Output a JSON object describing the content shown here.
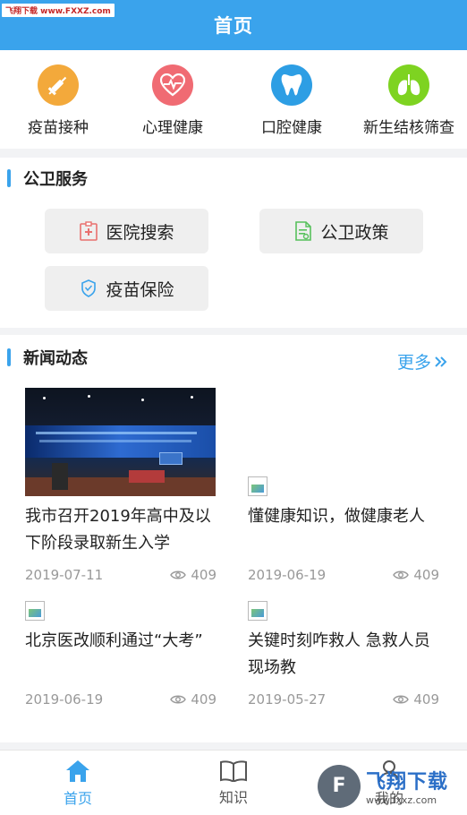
{
  "header": {
    "title": "首页"
  },
  "watermark": {
    "top": "飞翔下载 www.FXXZ.com",
    "brand": "飞翔下载",
    "url": "www.fxxz.com"
  },
  "quick_entries": [
    {
      "label": "疫苗接种",
      "icon": "syringe-icon",
      "color": "#f3a93b"
    },
    {
      "label": "心理健康",
      "icon": "heart-pulse-icon",
      "color": "#f06b73"
    },
    {
      "label": "口腔健康",
      "icon": "tooth-icon",
      "color": "#2d9ee4"
    },
    {
      "label": "新生结核筛查",
      "icon": "lungs-icon",
      "color": "#7ed321"
    }
  ],
  "public_health": {
    "title": "公卫服务",
    "services": [
      {
        "label": "医院搜索",
        "icon": "hospital-icon",
        "color": "#e9706f"
      },
      {
        "label": "公卫政策",
        "icon": "document-icon",
        "color": "#57c15c"
      },
      {
        "label": "疫苗保险",
        "icon": "shield-icon",
        "color": "#3aa3ec"
      }
    ]
  },
  "news": {
    "title": "新闻动态",
    "more_label": "更多",
    "items": [
      {
        "title": "我市召开2019年高中及以下阶段录取新生入学",
        "date": "2019-07-11",
        "views": "409"
      },
      {
        "title": "懂健康知识，做健康老人",
        "date": "2019-06-19",
        "views": "409"
      },
      {
        "title": "北京医改顺利通过“大考”",
        "date": "2019-06-19",
        "views": "409"
      },
      {
        "title": "关键时刻咋救人 急救人员现场教",
        "date": "2019-05-27",
        "views": "409"
      }
    ]
  },
  "tabs": [
    {
      "label": "首页",
      "icon": "home-icon",
      "active": true
    },
    {
      "label": "知识",
      "icon": "book-icon",
      "active": false
    },
    {
      "label": "我的",
      "icon": "user-icon",
      "active": false
    }
  ],
  "colors": {
    "primary": "#3aa3ec",
    "tab_inactive": "#666666"
  }
}
